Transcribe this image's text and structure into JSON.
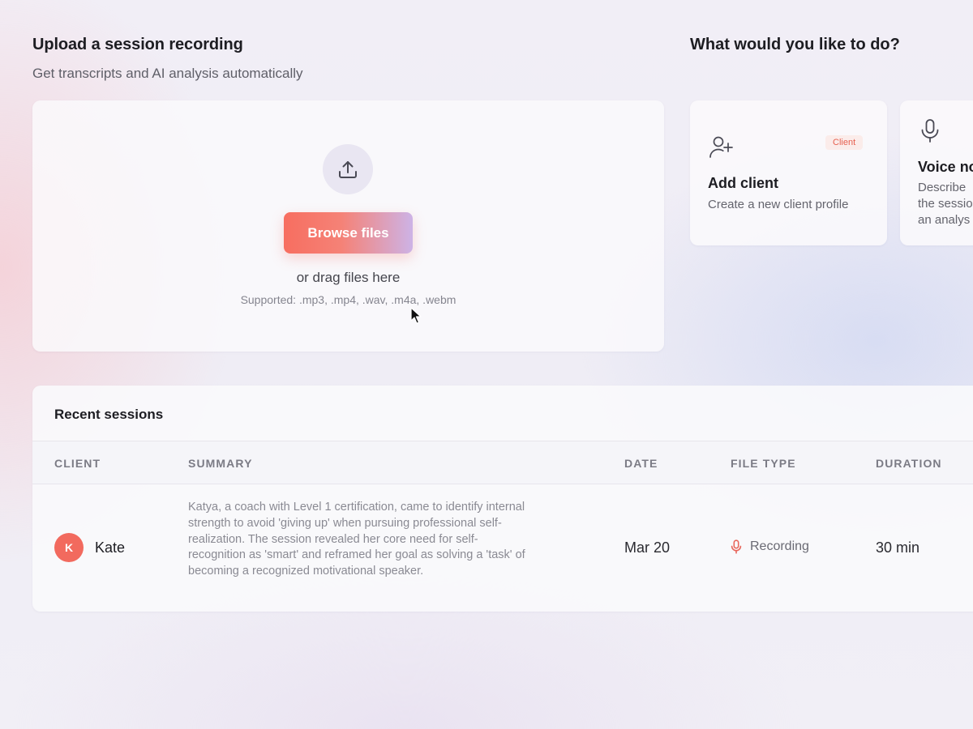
{
  "upload": {
    "title": "Upload a session recording",
    "subtitle": "Get transcripts and AI analysis automatically",
    "browse_label": "Browse files",
    "drag_text": "or drag files here",
    "supported_text": "Supported: .mp3, .mp4, .wav, .m4a, .webm",
    "icon": "upload-icon"
  },
  "actions": {
    "title": "What would you like to do?",
    "cards": [
      {
        "title": "Add client",
        "description": "Create a new client profile",
        "badge": "Client",
        "icon": "add-user-icon"
      },
      {
        "title": "Voice no",
        "description": "Describe\nthe sessio\nan analys",
        "icon": "microphone-icon"
      }
    ]
  },
  "sessions": {
    "title": "Recent sessions",
    "columns": [
      "CLIENT",
      "SUMMARY",
      "DATE",
      "FILE TYPE",
      "DURATION"
    ],
    "rows": [
      {
        "initial": "K",
        "client": "Kate",
        "summary": "Katya, a coach with Level 1 certification, came to identify internal strength to avoid 'giving up' when pursuing professional self-realization. The session revealed her core need for self-recognition as 'smart' and reframed her goal as solving a 'task' of becoming a recognized motivational speaker.",
        "date": "Mar 20",
        "file_type": "Recording",
        "file_type_icon": "microphone-icon",
        "duration": "30 min"
      }
    ]
  },
  "colors": {
    "accent": "#f26a5e",
    "gradient_end": "#cdb3e6",
    "badge_bg": "#fbecea",
    "badge_text": "#e66050"
  }
}
